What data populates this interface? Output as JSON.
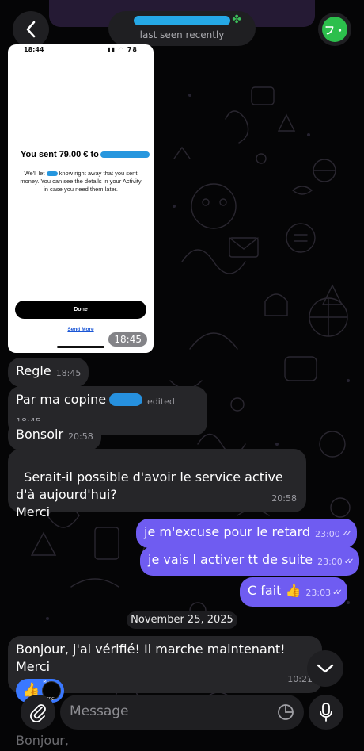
{
  "header": {
    "status": "last seen recently",
    "avatar_initials": "フ・"
  },
  "photo": {
    "status_time": "18:44",
    "status_icons": "▮▮ ◠ 78",
    "sent_text": "You sent 79.00 € to",
    "desc_before": "We'll let",
    "desc_after": "know right away that you sent money. You can see the details in your Activity in case you need them later.",
    "done_label": "Done",
    "send_more_label": "Send More",
    "time": "18:45"
  },
  "messages": [
    {
      "text": "Regle",
      "time": "18:45"
    },
    {
      "text": "Par ma copine",
      "time": "edited 18:45"
    },
    {
      "text": "Bonsoir",
      "time": "20:58"
    },
    {
      "text": "Serait-il possible d'avoir le service active d'à aujourd'hui?\nMerci",
      "time": "20:58"
    },
    {
      "text": "je m'excuse pour le retard",
      "time": "23:00"
    },
    {
      "text": "je vais l activer tt de suite",
      "time": "23:00"
    },
    {
      "text": "C fait 👍",
      "time": "23:03"
    },
    {
      "text": "Bonjour, j'ai vérifié! Il marche maintenant! Merci",
      "time": "10:21"
    }
  ],
  "date_separator": "November 25, 2025",
  "reaction": {
    "emoji": "👍",
    "avatar_text": "M ·  MERCI"
  },
  "input": {
    "placeholder": "Message"
  },
  "bottom_peek": "Bonjour,",
  "colors": {
    "incoming": "#262629",
    "outgoing": "#6f5cf1",
    "reaction": "#3a78ff"
  }
}
